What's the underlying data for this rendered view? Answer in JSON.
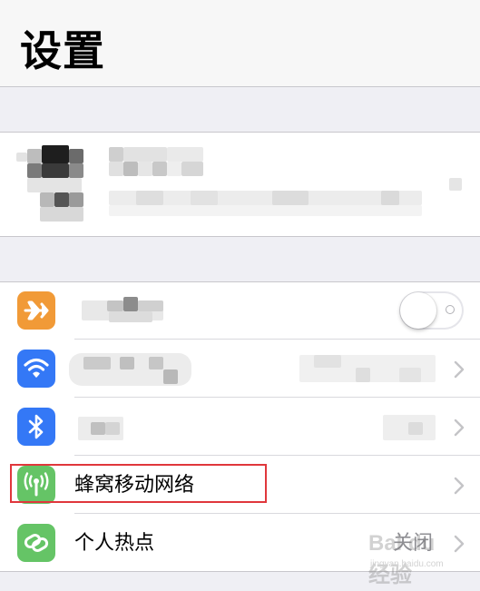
{
  "header": {
    "title": "设置"
  },
  "settings": {
    "airplane": {
      "icon": "airplane-icon",
      "color": "#f19a37",
      "toggle_on": false
    },
    "wifi": {
      "icon": "wifi-icon",
      "color": "#3478f6"
    },
    "bluetooth": {
      "icon": "bluetooth-icon",
      "color": "#3478f6"
    },
    "cellular": {
      "icon": "antenna-icon",
      "color": "#65c466",
      "label": "蜂窝移动网络"
    },
    "hotspot": {
      "icon": "hotspot-link-icon",
      "color": "#65c466",
      "label": "个人热点",
      "value": "关闭"
    }
  },
  "annotation": {
    "highlight_color": "#e0373c"
  },
  "watermark": {
    "text": "Bai du 经验",
    "sub": "jingyan.baidu.com"
  }
}
